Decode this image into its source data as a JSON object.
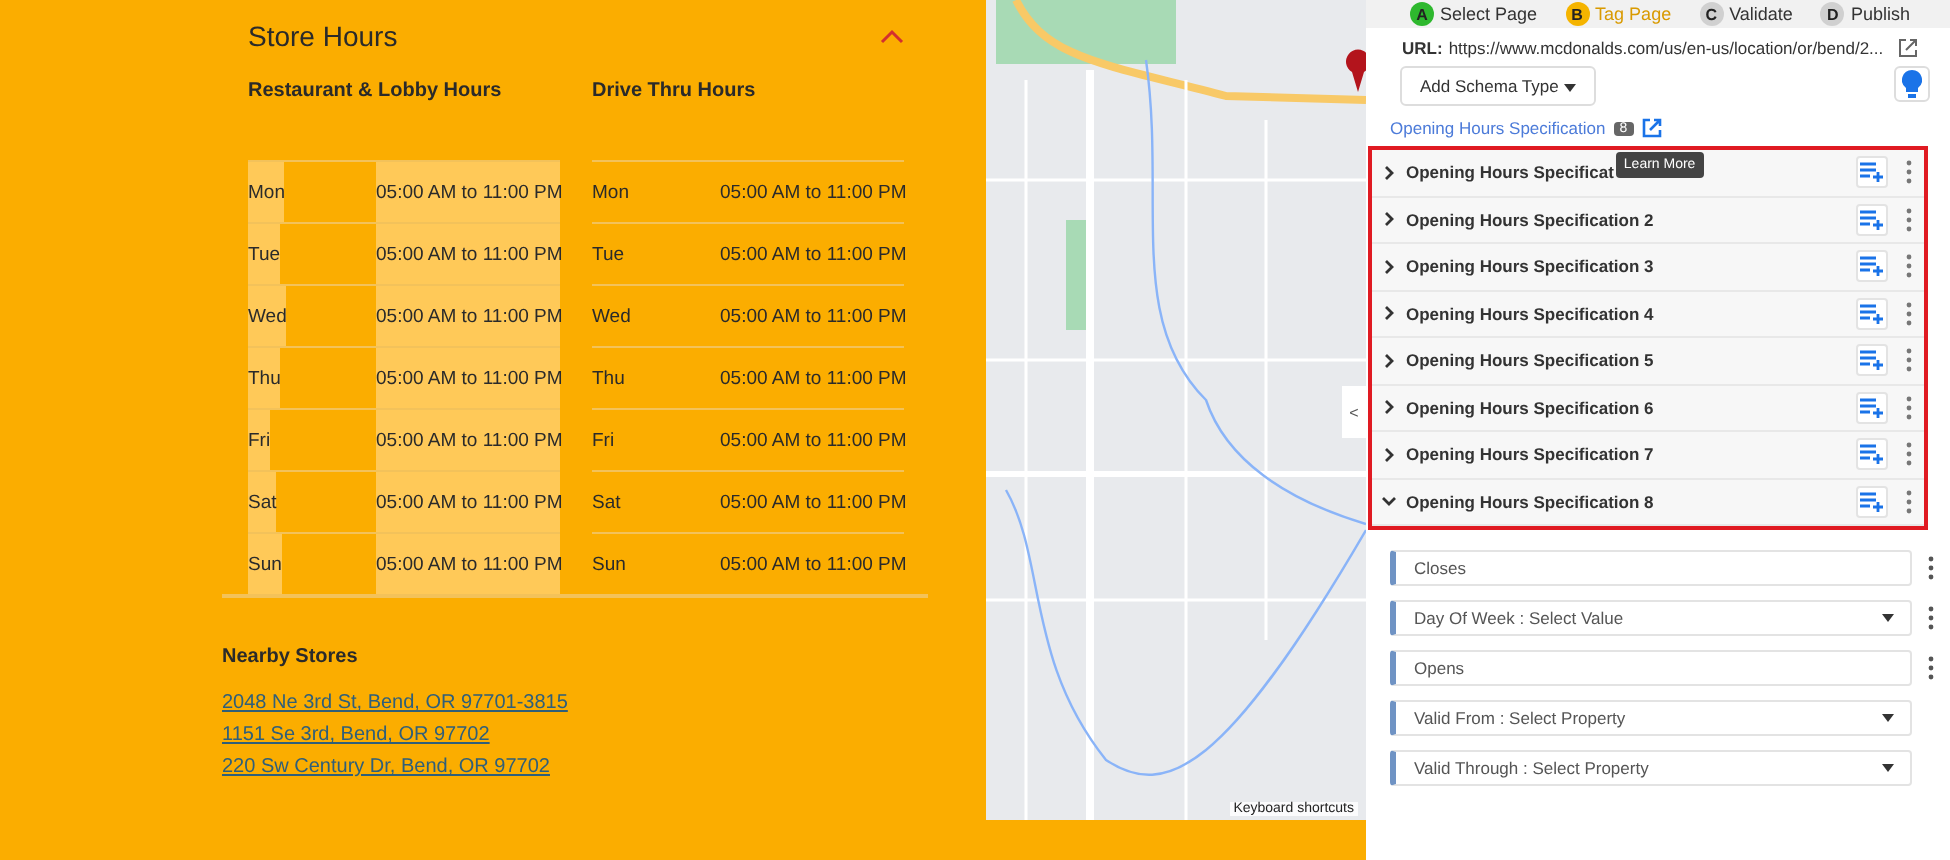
{
  "store_hours": {
    "title": "Store Hours",
    "expanded": true,
    "tables": [
      {
        "heading": "Restaurant & Lobby Hours",
        "highlighted": true,
        "rows": [
          {
            "day": "Mon",
            "hours": "05:00 AM to 11:00 PM"
          },
          {
            "day": "Tue",
            "hours": "05:00 AM to 11:00 PM"
          },
          {
            "day": "Wed",
            "hours": "05:00 AM to 11:00 PM"
          },
          {
            "day": "Thu",
            "hours": "05:00 AM to 11:00 PM"
          },
          {
            "day": "Fri",
            "hours": "05:00 AM to 11:00 PM"
          },
          {
            "day": "Sat",
            "hours": "05:00 AM to 11:00 PM"
          },
          {
            "day": "Sun",
            "hours": "05:00 AM to 11:00 PM"
          }
        ]
      },
      {
        "heading": "Drive Thru Hours",
        "highlighted": false,
        "rows": [
          {
            "day": "Mon",
            "hours": "05:00 AM to 11:00 PM"
          },
          {
            "day": "Tue",
            "hours": "05:00 AM to 11:00 PM"
          },
          {
            "day": "Wed",
            "hours": "05:00 AM to 11:00 PM"
          },
          {
            "day": "Thu",
            "hours": "05:00 AM to 11:00 PM"
          },
          {
            "day": "Fri",
            "hours": "05:00 AM to 11:00 PM"
          },
          {
            "day": "Sat",
            "hours": "05:00 AM to 11:00 PM"
          },
          {
            "day": "Sun",
            "hours": "05:00 AM to 11:00 PM"
          }
        ]
      }
    ]
  },
  "nearby_stores": {
    "title": "Nearby Stores",
    "links": [
      "2048 Ne 3rd St, Bend, OR 97701-3815",
      "1151 Se 3rd, Bend, OR 97702",
      "220 Sw Century Dr, Bend, OR 97702"
    ]
  },
  "map": {
    "shortcuts": "Keyboard shortcuts",
    "collapse": "<"
  },
  "steps": [
    {
      "letter": "A",
      "label": "Select Page",
      "done": true,
      "selected": false
    },
    {
      "letter": "B",
      "label": "Tag Page",
      "done": false,
      "selected": true
    },
    {
      "letter": "C",
      "label": "Validate",
      "done": false,
      "selected": false
    },
    {
      "letter": "D",
      "label": "Publish",
      "done": false,
      "selected": false
    }
  ],
  "url": {
    "label": "URL:",
    "value": "https://www.mcdonalds.com/us/en-us/location/or/bend/2..."
  },
  "add_schema": "Add Schema Type",
  "schema": {
    "name": "Opening Hours Specification",
    "count": "8",
    "tooltip": "Learn More"
  },
  "specs": [
    {
      "label": "Opening Hours Specificat",
      "expanded": false
    },
    {
      "label": "Opening Hours Specification 2",
      "expanded": false
    },
    {
      "label": "Opening Hours Specification 3",
      "expanded": false
    },
    {
      "label": "Opening Hours Specification 4",
      "expanded": false
    },
    {
      "label": "Opening Hours Specification 5",
      "expanded": false
    },
    {
      "label": "Opening Hours Specification 6",
      "expanded": false
    },
    {
      "label": "Opening Hours Specification 7",
      "expanded": false
    },
    {
      "label": "Opening Hours Specification 8",
      "expanded": true
    }
  ],
  "properties": [
    {
      "kind": "text",
      "label": "Closes",
      "menu": true
    },
    {
      "kind": "select",
      "label": "Day Of Week : Select Value",
      "menu": true
    },
    {
      "kind": "text",
      "label": "Opens",
      "menu": true
    },
    {
      "kind": "select",
      "label": "Valid From : Select Property",
      "menu": false
    },
    {
      "kind": "select",
      "label": "Valid Through : Select Property",
      "menu": false
    }
  ]
}
